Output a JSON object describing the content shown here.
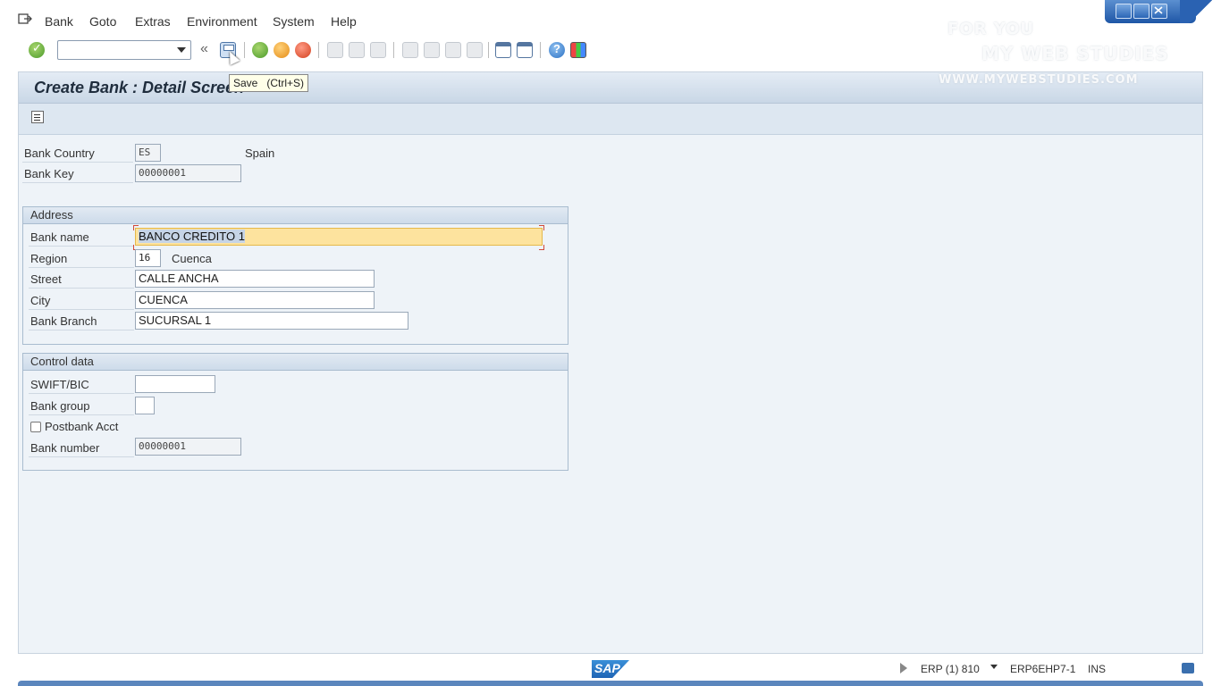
{
  "menu": {
    "items": [
      {
        "label": "Bank"
      },
      {
        "label": "Goto"
      },
      {
        "label": "Extras"
      },
      {
        "label": "Environment"
      },
      {
        "label": "System"
      },
      {
        "label": "Help"
      }
    ]
  },
  "toolbar": {
    "command_field_value": "",
    "double_back": "«",
    "tooltip": "Save   (Ctrl+S)"
  },
  "watermark": {
    "line1": "FOR YOU",
    "line2": "MY WEB STUDIES",
    "url": "WWW.MYWEBSTUDIES.COM"
  },
  "page": {
    "title": "Create Bank : Detail Screen"
  },
  "header_fields": {
    "bank_country_label": "Bank Country",
    "bank_country_value": "ES",
    "bank_country_name": "Spain",
    "bank_key_label": "Bank Key",
    "bank_key_value": "00000001"
  },
  "address": {
    "title": "Address",
    "bank_name_label": "Bank name",
    "bank_name_value": "BANCO CREDITO 1",
    "region_label": "Region",
    "region_value": "16",
    "region_name": "Cuenca",
    "street_label": "Street",
    "street_value": "CALLE ANCHA",
    "city_label": "City",
    "city_value": "CUENCA",
    "branch_label": "Bank Branch",
    "branch_value": "SUCURSAL 1"
  },
  "control": {
    "title": "Control data",
    "swift_label": "SWIFT/BIC",
    "swift_value": "",
    "group_label": "Bank group",
    "group_value": "",
    "postbank_label": "Postbank Acct",
    "postbank_checked": false,
    "number_label": "Bank number",
    "number_value": "00000001"
  },
  "status": {
    "sap_logo": "SAP",
    "system": "ERP (1) 810",
    "server": "ERP6EHP7-1",
    "mode": "INS"
  },
  "colors": {
    "accent": "#1e56a6",
    "focus_field": "#fde39e",
    "frame_bg": "#eef3f8"
  }
}
